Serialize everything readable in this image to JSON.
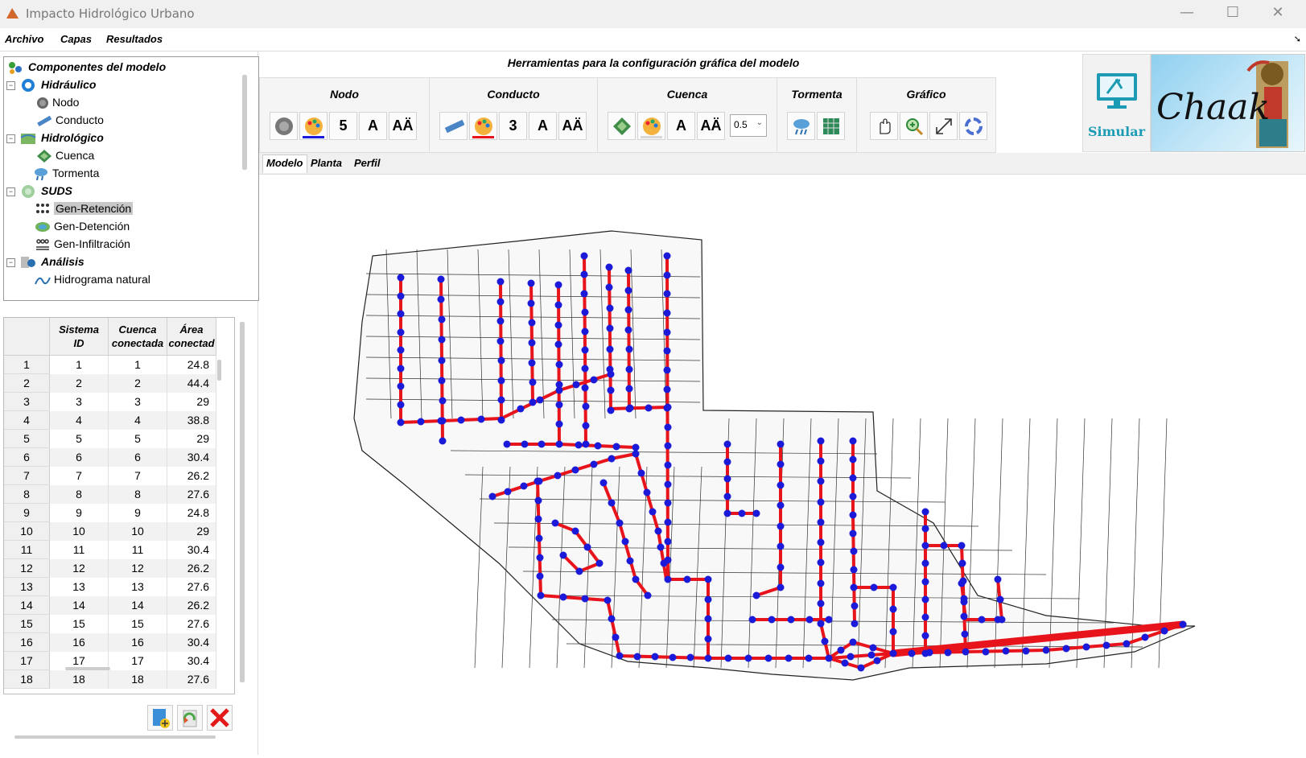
{
  "window": {
    "title": "Impacto Hidrológico Urbano",
    "minimize": "—",
    "maximize": "☐",
    "close": "✕"
  },
  "menu": {
    "items": [
      "Archivo",
      "Capas",
      "Resultados"
    ]
  },
  "tree": {
    "root": "Componentes del modelo",
    "groups": [
      {
        "label": "Hidráulico",
        "children": [
          "Nodo",
          "Conducto"
        ]
      },
      {
        "label": "Hidrológico",
        "children": [
          "Cuenca",
          "Tormenta"
        ]
      },
      {
        "label": "SUDS",
        "children": [
          "Gen-Retención",
          "Gen-Detención",
          "Gen-Infiltración"
        ]
      },
      {
        "label": "Análisis",
        "children": [
          "Hidrograma natural"
        ]
      }
    ],
    "selected": "Gen-Retención"
  },
  "table": {
    "headers": [
      [
        "Sistema",
        "ID"
      ],
      [
        "Cuenca",
        "conectada"
      ],
      [
        "Área",
        "conectad"
      ]
    ],
    "rows": [
      [
        "1",
        "1",
        "1",
        "24.8"
      ],
      [
        "2",
        "2",
        "2",
        "44.4"
      ],
      [
        "3",
        "3",
        "3",
        "29"
      ],
      [
        "4",
        "4",
        "4",
        "38.8"
      ],
      [
        "5",
        "5",
        "5",
        "29"
      ],
      [
        "6",
        "6",
        "6",
        "30.4"
      ],
      [
        "7",
        "7",
        "7",
        "26.2"
      ],
      [
        "8",
        "8",
        "8",
        "27.6"
      ],
      [
        "9",
        "9",
        "9",
        "24.8"
      ],
      [
        "10",
        "10",
        "10",
        "29"
      ],
      [
        "11",
        "11",
        "11",
        "30.4"
      ],
      [
        "12",
        "12",
        "12",
        "26.2"
      ],
      [
        "13",
        "13",
        "13",
        "27.6"
      ],
      [
        "14",
        "14",
        "14",
        "26.2"
      ],
      [
        "15",
        "15",
        "15",
        "27.6"
      ],
      [
        "16",
        "16",
        "16",
        "30.4"
      ],
      [
        "17",
        "17",
        "17",
        "30.4"
      ],
      [
        "18",
        "18",
        "18",
        "27.6"
      ]
    ]
  },
  "tools": {
    "title": "Herramientas para la configuración gráfica del modelo",
    "groups": {
      "nodo": {
        "label": "Nodo",
        "size": "5",
        "text": "A",
        "text_size": "AÄ"
      },
      "conducto": {
        "label": "Conducto",
        "size": "3",
        "text": "A",
        "text_size": "AÄ"
      },
      "cuenca": {
        "label": "Cuenca",
        "text": "A",
        "text_size": "AÄ",
        "select_value": "0.5"
      },
      "tormenta": {
        "label": "Tormenta"
      },
      "grafico": {
        "label": "Gráfico"
      }
    },
    "simular": "Simular",
    "logo_text": "Chaak"
  },
  "tabs": [
    "Modelo",
    "Planta",
    "Perfil"
  ],
  "colors": {
    "conduit": "#e8141b",
    "node": "#1a1ad8",
    "accent_teal": "#1c9bb5"
  }
}
